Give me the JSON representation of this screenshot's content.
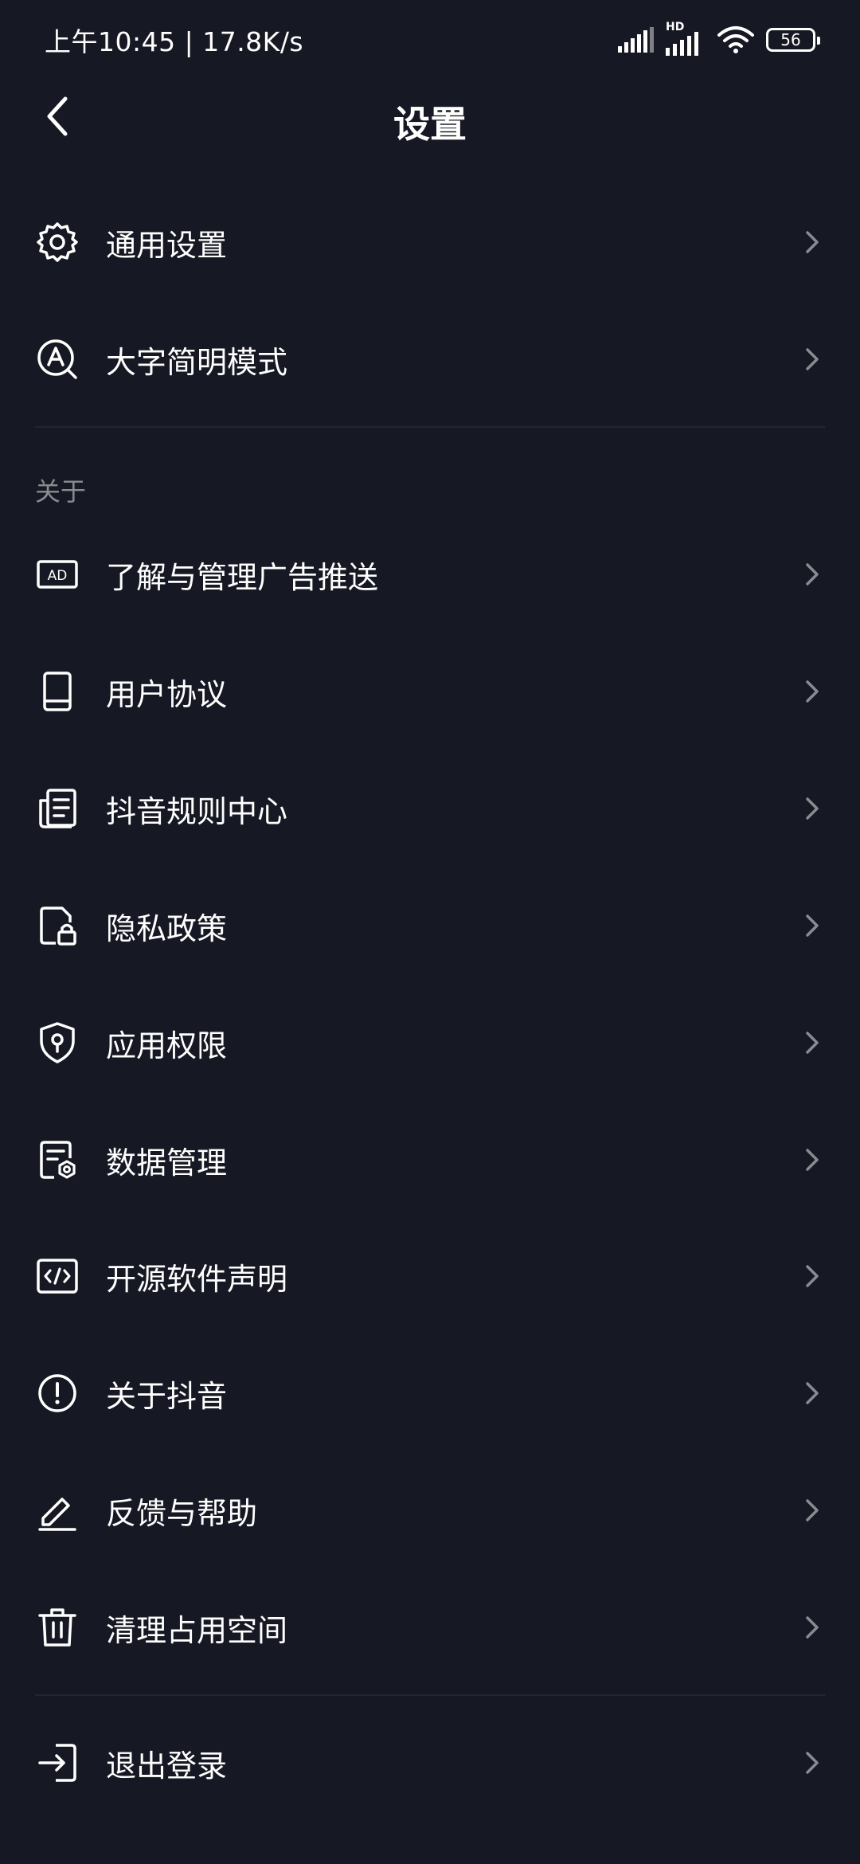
{
  "status_bar": {
    "time_speed": "上午10:45 | 17.8K/s",
    "network_label": "HD",
    "battery": "56"
  },
  "header": {
    "title": "设置"
  },
  "general": [
    {
      "label": "通用设置",
      "icon": "gear-icon"
    },
    {
      "label": "大字简明模式",
      "icon": "large-font-icon"
    }
  ],
  "about_section": {
    "title": "关于",
    "items": [
      {
        "label": "了解与管理广告推送",
        "icon": "ad-icon"
      },
      {
        "label": "用户协议",
        "icon": "book-icon"
      },
      {
        "label": "抖音规则中心",
        "icon": "document-list-icon"
      },
      {
        "label": "隐私政策",
        "icon": "privacy-lock-icon"
      },
      {
        "label": "应用权限",
        "icon": "shield-icon"
      },
      {
        "label": "数据管理",
        "icon": "data-settings-icon"
      },
      {
        "label": "开源软件声明",
        "icon": "code-icon"
      },
      {
        "label": "关于抖音",
        "icon": "info-circle-icon"
      },
      {
        "label": "反馈与帮助",
        "icon": "pen-icon"
      },
      {
        "label": "清理占用空间",
        "icon": "trash-icon"
      }
    ]
  },
  "logout": {
    "label": "退出登录",
    "icon": "logout-icon"
  },
  "colors": {
    "background": "#161823",
    "text": "#ffffff",
    "secondary_text": "#8a8b91",
    "chevron": "#8a8b91",
    "divider": "#24262f"
  }
}
